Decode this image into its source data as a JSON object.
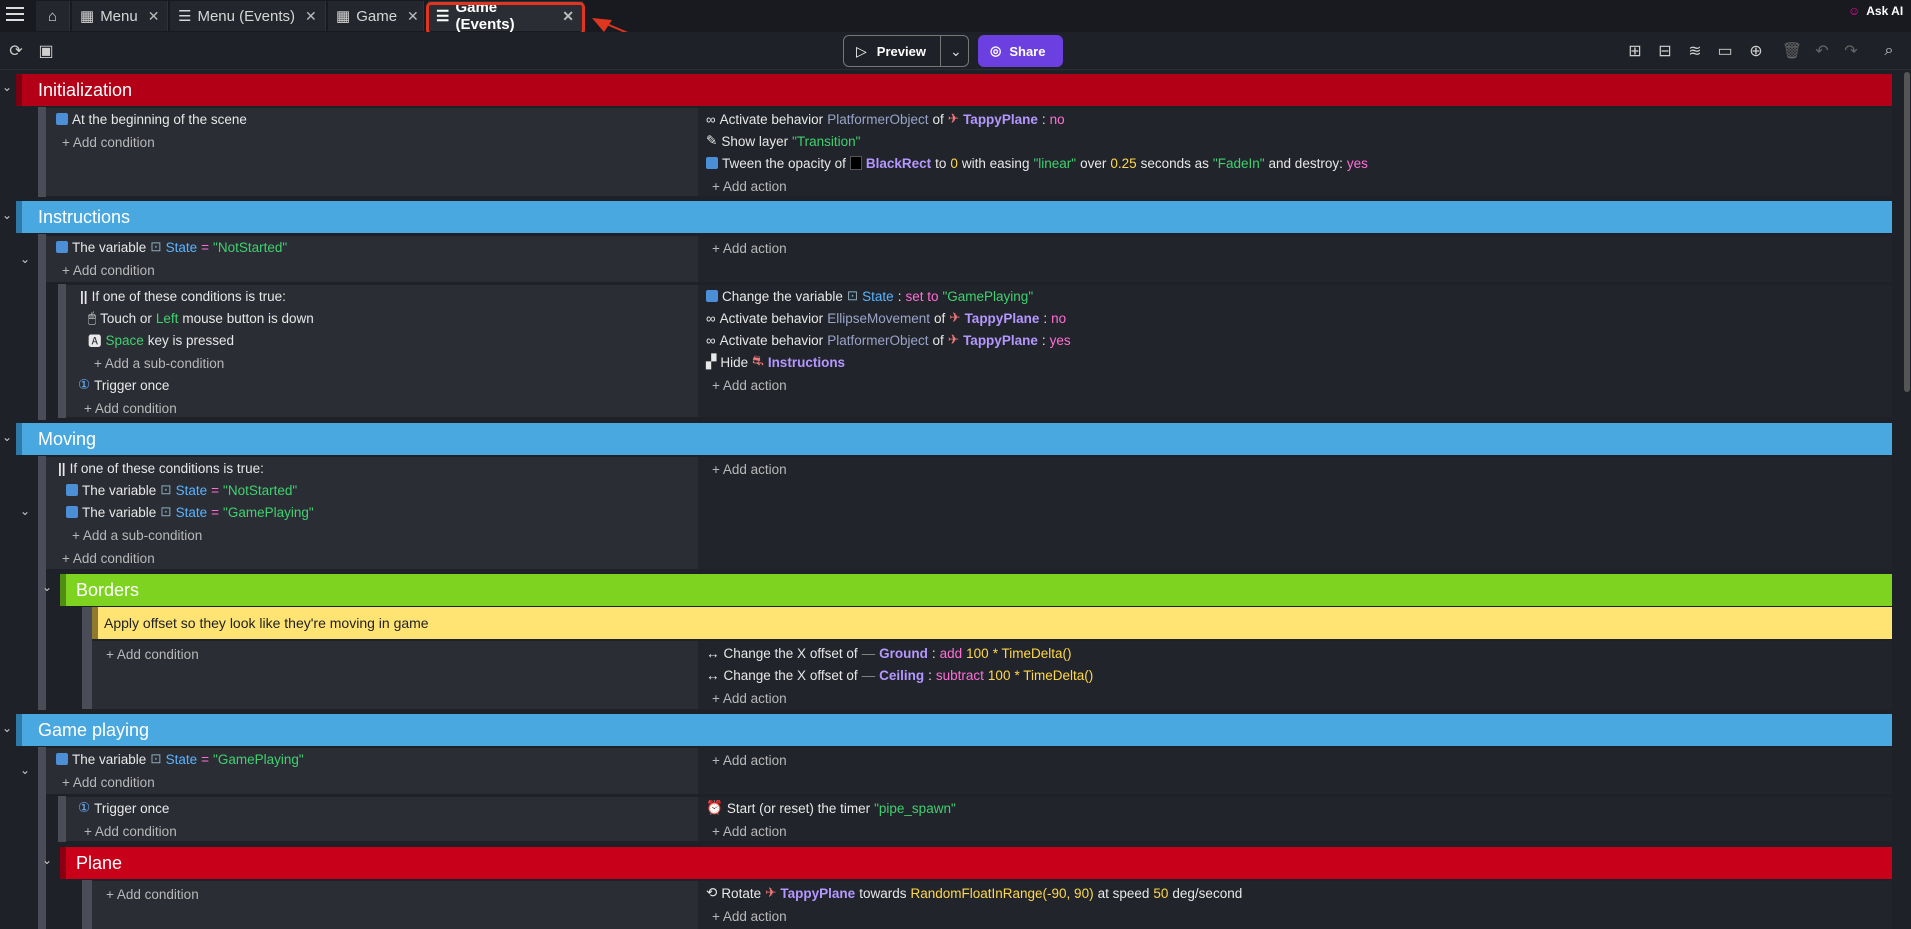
{
  "tabs": [
    {
      "label": "Menu"
    },
    {
      "label": "Menu (Events)"
    },
    {
      "label": "Game"
    },
    {
      "label": "Game (Events)"
    }
  ],
  "topright": {
    "label": "Ask AI"
  },
  "toolbar": {
    "preview": "Preview",
    "share": "Share"
  },
  "groups": {
    "init": "Initialization",
    "instr": "Instructions",
    "moving": "Moving",
    "borders": "Borders",
    "gameplay": "Game playing",
    "plane": "Plane"
  },
  "comment": "Apply offset so they look like they're moving in game",
  "text": {
    "add_condition": "+ Add condition",
    "add_action": "+ Add action",
    "add_sub": "+ Add a sub-condition",
    "begin_scene": "At the beginning of the scene",
    "activate_behavior": "Activate behavior",
    "of": "of",
    "platformer": "PlatformerObject",
    "ellipse": "EllipseMovement",
    "tappy": "TappyPlane",
    "no": "no",
    "yes": "yes",
    "show_layer": "Show layer",
    "transition": "\"Transition\"",
    "tween": "Tween the opacity of",
    "blackrect": "BlackRect",
    "to": "to",
    "zero": "0",
    "with_easing": "with easing",
    "linear": "\"linear\"",
    "over": "over",
    "dur": "0.25",
    "seconds_as": "seconds as",
    "fadein": "\"FadeIn\"",
    "and_destroy": "and destroy:",
    "the_variable": "The variable",
    "state": "State",
    "eq": "=",
    "notstarted": "\"NotStarted\"",
    "gameplaying": "\"GamePlaying\"",
    "if_one": "If one of these conditions is true:",
    "touch_or": "Touch or",
    "left": "Left",
    "mouse_down": "mouse button is down",
    "space": "Space",
    "key_pressed": "key is pressed",
    "trigger_once": "Trigger once",
    "change_var": "Change the variable",
    "set_to": "set to",
    "hide": "Hide",
    "instructions_obj": "Instructions",
    "change_x": "Change the X offset of",
    "ground": "Ground",
    "ceiling": "Ceiling",
    "add": "add",
    "subtract": "subtract",
    "hundred": "100",
    "times_delta": "* TimeDelta()",
    "start_timer": "Start (or reset) the timer",
    "pipe_spawn": "\"pipe_spawn\"",
    "rotate": "Rotate",
    "towards": "towards",
    "random": "RandomFloatInRange(-90, 90)",
    "at_speed": "at speed",
    "fifty": "50",
    "degsec": "deg/second"
  }
}
